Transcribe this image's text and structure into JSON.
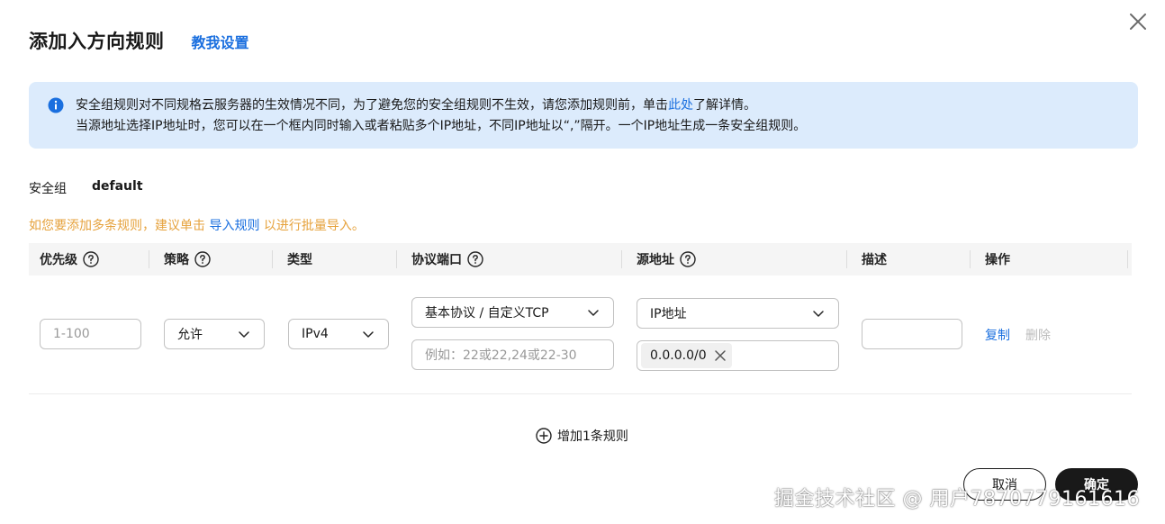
{
  "dialog": {
    "title": "添加入方向规则",
    "help_link": "教我设置",
    "close_icon": "close-icon"
  },
  "info": {
    "icon": "info-icon",
    "line1_prefix": "安全组规则对不同规格云服务器的生效情况不同，为了避免您的安全组规则不生效，请您添加规则前，单击",
    "line1_link": "此处",
    "line1_suffix": "了解详情。",
    "line2": "当源地址选择IP地址时，您可以在一个框内同时输入或者粘贴多个IP地址，不同IP地址以“,”隔开。一个IP地址生成一条安全组规则。"
  },
  "security_group": {
    "label": "安全组",
    "value": "default"
  },
  "tip": {
    "prefix": "如您要添加多条规则，建议单击",
    "link": "导入规则",
    "suffix": "以进行批量导入。"
  },
  "table": {
    "columns": [
      {
        "label": "优先级",
        "help": true
      },
      {
        "label": "策略",
        "help": true
      },
      {
        "label": "类型",
        "help": false
      },
      {
        "label": "协议端口",
        "help": true
      },
      {
        "label": "源地址",
        "help": true
      },
      {
        "label": "描述",
        "help": false
      },
      {
        "label": "操作",
        "help": false
      }
    ],
    "row": {
      "priority_placeholder": "1-100",
      "policy": "允许",
      "type": "IPv4",
      "protocol": "基本协议 / 自定义TCP",
      "port_placeholder": "例如：22或22,24或22-30",
      "source_type": "IP地址",
      "source_tag": "0.0.0.0/0",
      "description": "",
      "op_copy": "复制",
      "op_delete": "删除"
    }
  },
  "add_rule": "增加1条规则",
  "buttons": {
    "cancel": "取消",
    "ok": "确定"
  },
  "watermark": "掘金技术社区 @ 用户7870779161616",
  "colors": {
    "accent": "#1a6fdf",
    "tip": "#e6a23c",
    "info_bg": "#dcebfc",
    "primary_button": "#191919"
  }
}
